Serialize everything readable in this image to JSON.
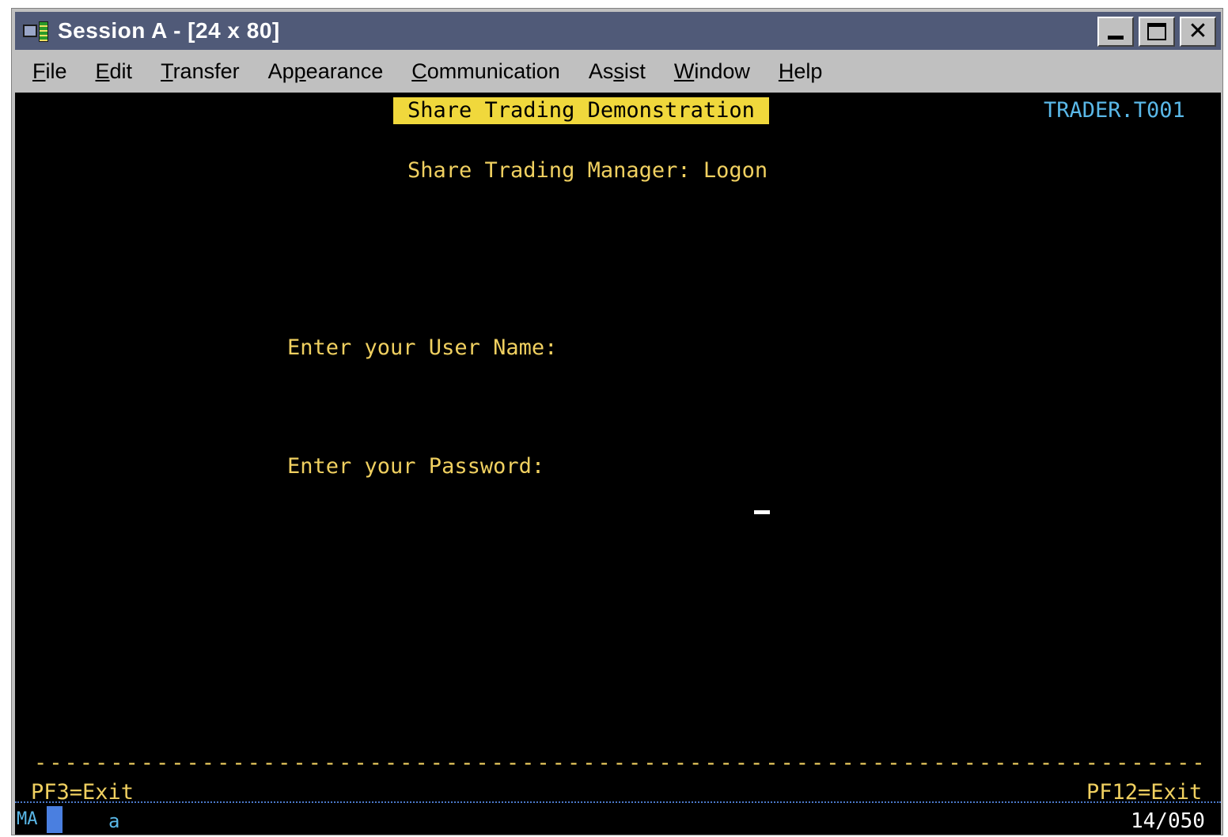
{
  "window": {
    "title": "Session A - [24 x 80]",
    "close_glyph": "✕"
  },
  "menu": [
    "File",
    "Edit",
    "Transfer",
    "Appearance",
    "Communication",
    "Assist",
    "Window",
    "Help"
  ],
  "screen": {
    "banner": "Share Trading Demonstration",
    "transaction_id": "TRADER.T001",
    "subtitle": "Share Trading Manager: Logon",
    "username_label": "Enter your User Name:",
    "password_label": "Enter your Password:",
    "username_value": "",
    "password_value": "",
    "divider": "-------------------------------------------------------------------------------",
    "pf_left": "PF3=Exit",
    "pf_right": "PF12=Exit"
  },
  "status": {
    "indicator": "MA",
    "input_mode": "a",
    "cursor_position": "14/050"
  },
  "colors": {
    "title_bar": "#505a78",
    "terminal_text": "#f0d060",
    "banner_bg": "#f0d83c",
    "transaction_id": "#5ab8e8"
  },
  "icons": [
    "app-session-icon",
    "minimize-icon",
    "maximize-icon",
    "close-icon"
  ]
}
